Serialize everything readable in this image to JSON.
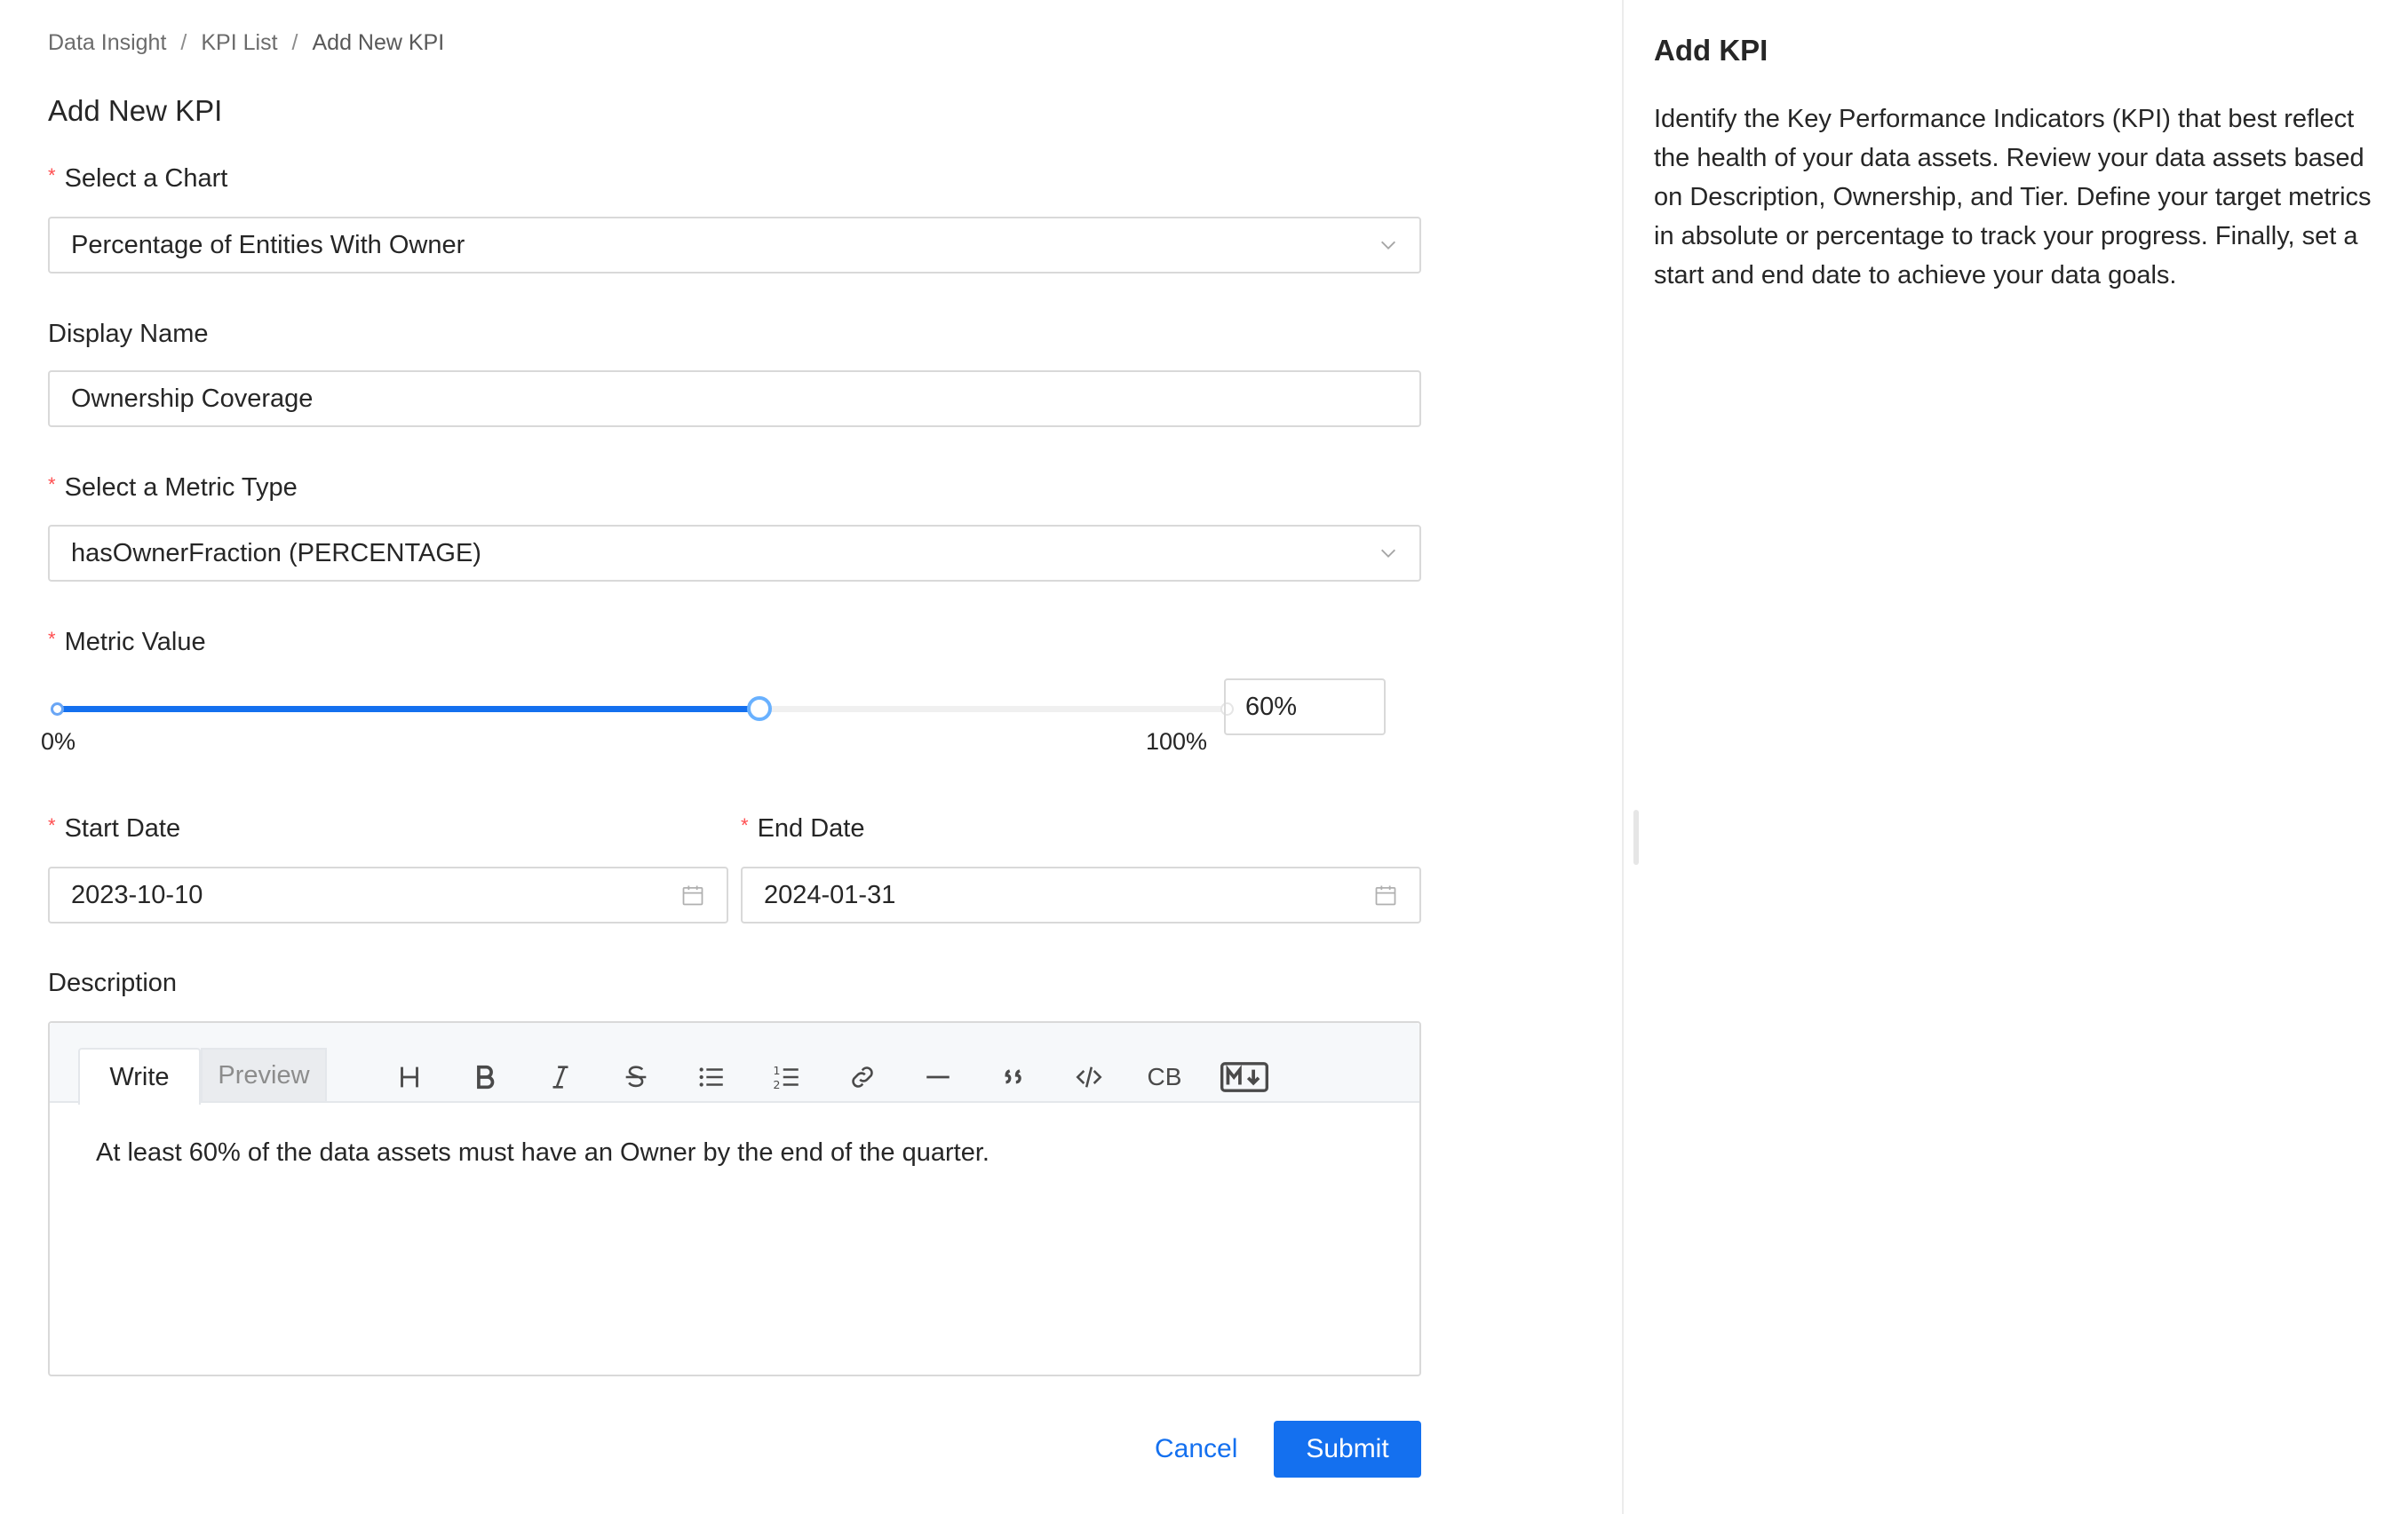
{
  "breadcrumb": {
    "items": [
      "Data Insight",
      "KPI List",
      "Add New KPI"
    ],
    "separator": "/"
  },
  "page_title": "Add New KPI",
  "form": {
    "chart": {
      "label": "Select a Chart",
      "required": true,
      "value": "Percentage of Entities With Owner"
    },
    "display_name": {
      "label": "Display Name",
      "value": "Ownership Coverage"
    },
    "metric_type": {
      "label": "Select a Metric Type",
      "required": true,
      "value": "hasOwnerFraction (PERCENTAGE)"
    },
    "metric_value": {
      "label": "Metric Value",
      "required": true,
      "min_label": "0%",
      "max_label": "100%",
      "percent": 60,
      "input_value": "60%"
    },
    "start_date": {
      "label": "Start Date",
      "required": true,
      "value": "2023-10-10"
    },
    "end_date": {
      "label": "End Date",
      "required": true,
      "value": "2024-01-31"
    },
    "description": {
      "label": "Description",
      "tabs": [
        "Write",
        "Preview"
      ],
      "active_tab": "Write",
      "toolbar": [
        "heading-icon",
        "bold-icon",
        "italic-icon",
        "strikethrough-icon",
        "bullet-list-icon",
        "numbered-list-icon",
        "link-icon",
        "horizontal-rule-icon",
        "quote-icon",
        "code-icon",
        "CB",
        "markdown-icon"
      ],
      "content": "At least 60% of the data assets must have an Owner by the end of the quarter."
    }
  },
  "actions": {
    "cancel": "Cancel",
    "submit": "Submit"
  },
  "panel": {
    "title": "Add KPI",
    "description": "Identify the Key Performance Indicators (KPI) that best reflect the health of your data assets. Review your data assets based on Description, Ownership, and Tier. Define your target metrics in absolute or percentage to track your progress. Finally, set a start and end date to achieve your data goals."
  },
  "colors": {
    "primary": "#1470ef",
    "required": "#ff4d4f",
    "border": "#d9d9d9"
  }
}
